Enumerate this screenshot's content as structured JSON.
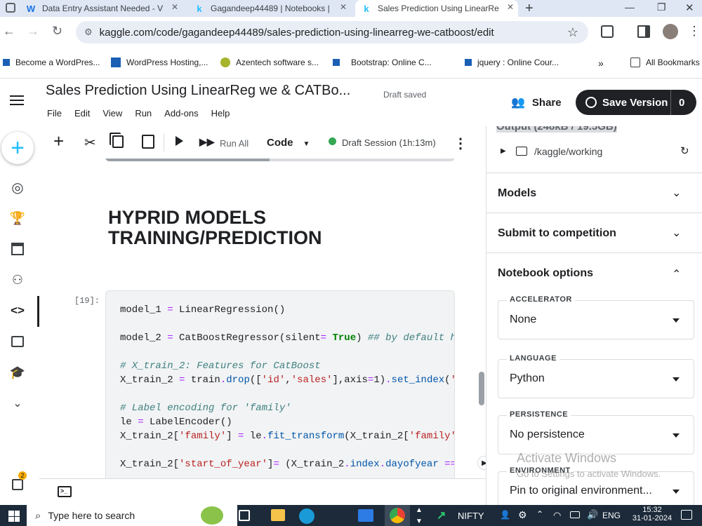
{
  "browser": {
    "tabs": [
      {
        "title": "Data Entry Assistant Needed - V",
        "favicon": "W",
        "active": false
      },
      {
        "title": "Gagandeep44489 | Notebooks |",
        "favicon": "k",
        "active": false
      },
      {
        "title": "Sales Prediction Using LinearRe",
        "favicon": "k",
        "active": true
      }
    ],
    "url": "kaggle.com/code/gagandeep44489/sales-prediction-using-linearreg-we-catboost/edit",
    "bookmarks": [
      "Become a WordPres...",
      "WordPress Hosting,...",
      "Azentech software s...",
      "Bootstrap: Online C...",
      "jquery : Online Cour..."
    ],
    "all_bookmarks": "All Bookmarks"
  },
  "app": {
    "notebook_title": "Sales Prediction Using LinearReg we & CATBo...",
    "save_status": "Draft saved",
    "menu": [
      "File",
      "Edit",
      "View",
      "Run",
      "Add-ons",
      "Help"
    ],
    "share_label": "Share",
    "save_version_label": "Save Version",
    "save_version_count": "0"
  },
  "toolbar": {
    "run_all_label": "Run All",
    "cell_type": "Code",
    "session_status": "Draft Session (1h:13m)"
  },
  "notebook": {
    "heading_line1": "HYPRID MODELS",
    "heading_line2": "TRAINING/PREDICTION",
    "cell_prompt": "[19]:"
  },
  "right_panel": {
    "output_header": "Output (248kB / 19.5GB)",
    "working_dir": "/kaggle/working",
    "models_label": "Models",
    "submit_label": "Submit to competition",
    "notebook_options_label": "Notebook options",
    "accelerator": {
      "label": "ACCELERATOR",
      "value": "None"
    },
    "language": {
      "label": "LANGUAGE",
      "value": "Python"
    },
    "persistence": {
      "label": "PERSISTENCE",
      "value": "No persistence"
    },
    "environment": {
      "label": "ENVIRONMENT",
      "value": "Pin to original environment..."
    }
  },
  "watermark": {
    "line1": "Activate Windows",
    "line2": "Go to Settings to activate Windows."
  },
  "taskbar": {
    "search_placeholder": "Type here to search",
    "ticker": "NIFTY",
    "language": "ENG",
    "time": "15:32",
    "date": "31-01-2024",
    "notification_badge": "2"
  },
  "colors": {
    "accent_blue": "#1a73e8",
    "kaggle_blue": "#20beff",
    "session_green": "#34a853",
    "dark": "#202124",
    "taskbar": "#1c2a3a"
  }
}
